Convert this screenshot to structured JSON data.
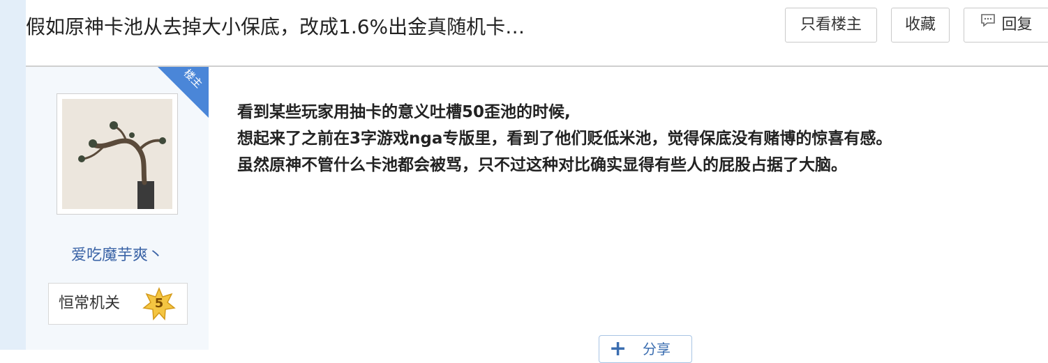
{
  "thread": {
    "title": "假如原神卡池从去掉大小保底，改成1.6%出金真随机卡…"
  },
  "toolbar": {
    "only_op_label": "只看楼主",
    "favorite_label": "收藏",
    "reply_label": "回复",
    "reply_icon": "comment-icon"
  },
  "author": {
    "op_badge": "楼主",
    "username": "爱吃魔芋爽丶",
    "level_name": "恒常机关",
    "level_number": "5"
  },
  "post": {
    "lines": [
      "看到某些玩家用抽卡的意义吐槽50歪池的时候,",
      "想起来了之前在3字游戏nga专版里，看到了他们贬低米池，觉得保底没有赌博的惊喜有感。",
      "虽然原神不管什么卡池都会被骂，只不过这种对比确实显得有些人的屁股占据了大脑。"
    ]
  },
  "share": {
    "label": "分享"
  },
  "colors": {
    "rail": "#e3eef9",
    "author_bg": "#f4f8fc",
    "link": "#3a63a6",
    "ribbon": "#4a86d8"
  }
}
